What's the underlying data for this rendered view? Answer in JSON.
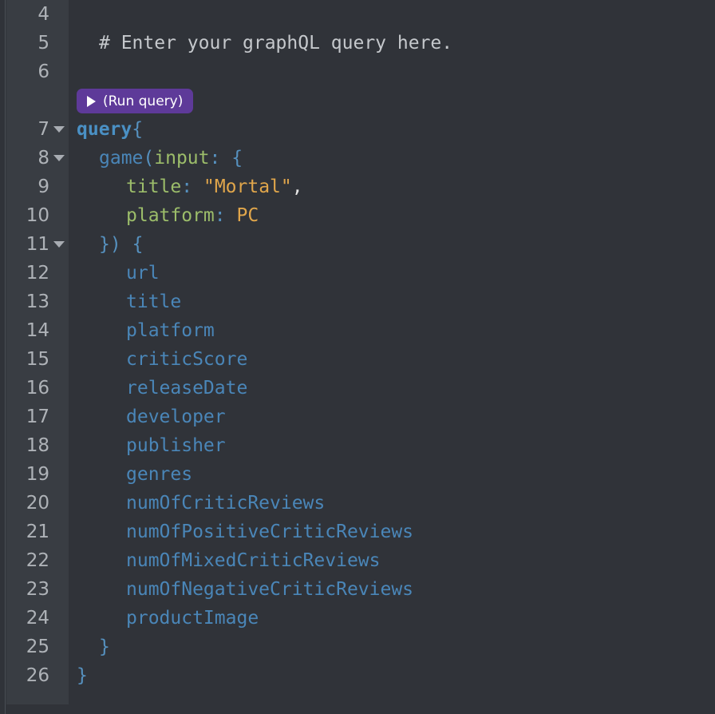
{
  "editor": {
    "name": "graphql-query-editor",
    "language": "graphql",
    "colors": {
      "background": "#303339",
      "gutter_background": "#393D43",
      "line_number": "#aeb2b7",
      "comment": "#c5c8cc",
      "keyword": "#4A90C4",
      "field": "#4A86B8",
      "argument": "#9CBD6A",
      "string": "#E0A64B",
      "enum": "#E0A64B",
      "punctuation": "#5691BF",
      "run_button": "#5E3A99"
    },
    "first_visible_line": 4,
    "last_visible_line": 26
  },
  "run_button": {
    "label": "(Run query)",
    "icon": "play-icon"
  },
  "lines": [
    {
      "number": "4",
      "foldable": false,
      "indent": 0,
      "tokens": []
    },
    {
      "number": "5",
      "foldable": false,
      "indent": 1,
      "tokens": [
        {
          "t": "comment",
          "v": "# Enter your graphQL query here."
        }
      ]
    },
    {
      "number": "6",
      "foldable": false,
      "indent": 0,
      "tokens": []
    },
    {
      "number": "7",
      "foldable": true,
      "indent": 0,
      "tokens": [
        {
          "t": "keyword",
          "v": "query"
        },
        {
          "t": "punct",
          "v": "{"
        }
      ]
    },
    {
      "number": "8",
      "foldable": true,
      "indent": 1,
      "tokens": [
        {
          "t": "field",
          "v": "game"
        },
        {
          "t": "punct",
          "v": "("
        },
        {
          "t": "arg",
          "v": "input"
        },
        {
          "t": "punct",
          "v": ":"
        },
        {
          "t": "plain",
          "v": " "
        },
        {
          "t": "punct",
          "v": "{"
        }
      ]
    },
    {
      "number": "9",
      "foldable": false,
      "indent": 2,
      "tokens": [
        {
          "t": "arg",
          "v": "title"
        },
        {
          "t": "punct",
          "v": ":"
        },
        {
          "t": "plain",
          "v": " "
        },
        {
          "t": "string",
          "v": "\"Mortal\""
        },
        {
          "t": "plain",
          "v": ","
        }
      ]
    },
    {
      "number": "10",
      "foldable": false,
      "indent": 2,
      "tokens": [
        {
          "t": "arg",
          "v": "platform"
        },
        {
          "t": "punct",
          "v": ":"
        },
        {
          "t": "plain",
          "v": " "
        },
        {
          "t": "enum",
          "v": "PC"
        }
      ]
    },
    {
      "number": "11",
      "foldable": true,
      "indent": 1,
      "tokens": [
        {
          "t": "punct",
          "v": "})"
        },
        {
          "t": "plain",
          "v": " "
        },
        {
          "t": "punct",
          "v": "{"
        }
      ]
    },
    {
      "number": "12",
      "foldable": false,
      "indent": 2,
      "tokens": [
        {
          "t": "field",
          "v": "url"
        }
      ]
    },
    {
      "number": "13",
      "foldable": false,
      "indent": 2,
      "tokens": [
        {
          "t": "field",
          "v": "title"
        }
      ]
    },
    {
      "number": "14",
      "foldable": false,
      "indent": 2,
      "tokens": [
        {
          "t": "field",
          "v": "platform"
        }
      ]
    },
    {
      "number": "15",
      "foldable": false,
      "indent": 2,
      "tokens": [
        {
          "t": "field",
          "v": "criticScore"
        }
      ]
    },
    {
      "number": "16",
      "foldable": false,
      "indent": 2,
      "tokens": [
        {
          "t": "field",
          "v": "releaseDate"
        }
      ]
    },
    {
      "number": "17",
      "foldable": false,
      "indent": 2,
      "tokens": [
        {
          "t": "field",
          "v": "developer"
        }
      ]
    },
    {
      "number": "18",
      "foldable": false,
      "indent": 2,
      "tokens": [
        {
          "t": "field",
          "v": "publisher"
        }
      ]
    },
    {
      "number": "19",
      "foldable": false,
      "indent": 2,
      "tokens": [
        {
          "t": "field",
          "v": "genres"
        }
      ]
    },
    {
      "number": "20",
      "foldable": false,
      "indent": 2,
      "tokens": [
        {
          "t": "field",
          "v": "numOfCriticReviews"
        }
      ]
    },
    {
      "number": "21",
      "foldable": false,
      "indent": 2,
      "tokens": [
        {
          "t": "field",
          "v": "numOfPositiveCriticReviews"
        }
      ]
    },
    {
      "number": "22",
      "foldable": false,
      "indent": 2,
      "tokens": [
        {
          "t": "field",
          "v": "numOfMixedCriticReviews"
        }
      ]
    },
    {
      "number": "23",
      "foldable": false,
      "indent": 2,
      "tokens": [
        {
          "t": "field",
          "v": "numOfNegativeCriticReviews"
        }
      ]
    },
    {
      "number": "24",
      "foldable": false,
      "indent": 2,
      "tokens": [
        {
          "t": "field",
          "v": "productImage"
        }
      ]
    },
    {
      "number": "25",
      "foldable": false,
      "indent": 1,
      "tokens": [
        {
          "t": "punct",
          "v": "}"
        }
      ]
    },
    {
      "number": "26",
      "foldable": false,
      "indent": 0,
      "tokens": [
        {
          "t": "punct",
          "v": "}"
        }
      ]
    }
  ]
}
